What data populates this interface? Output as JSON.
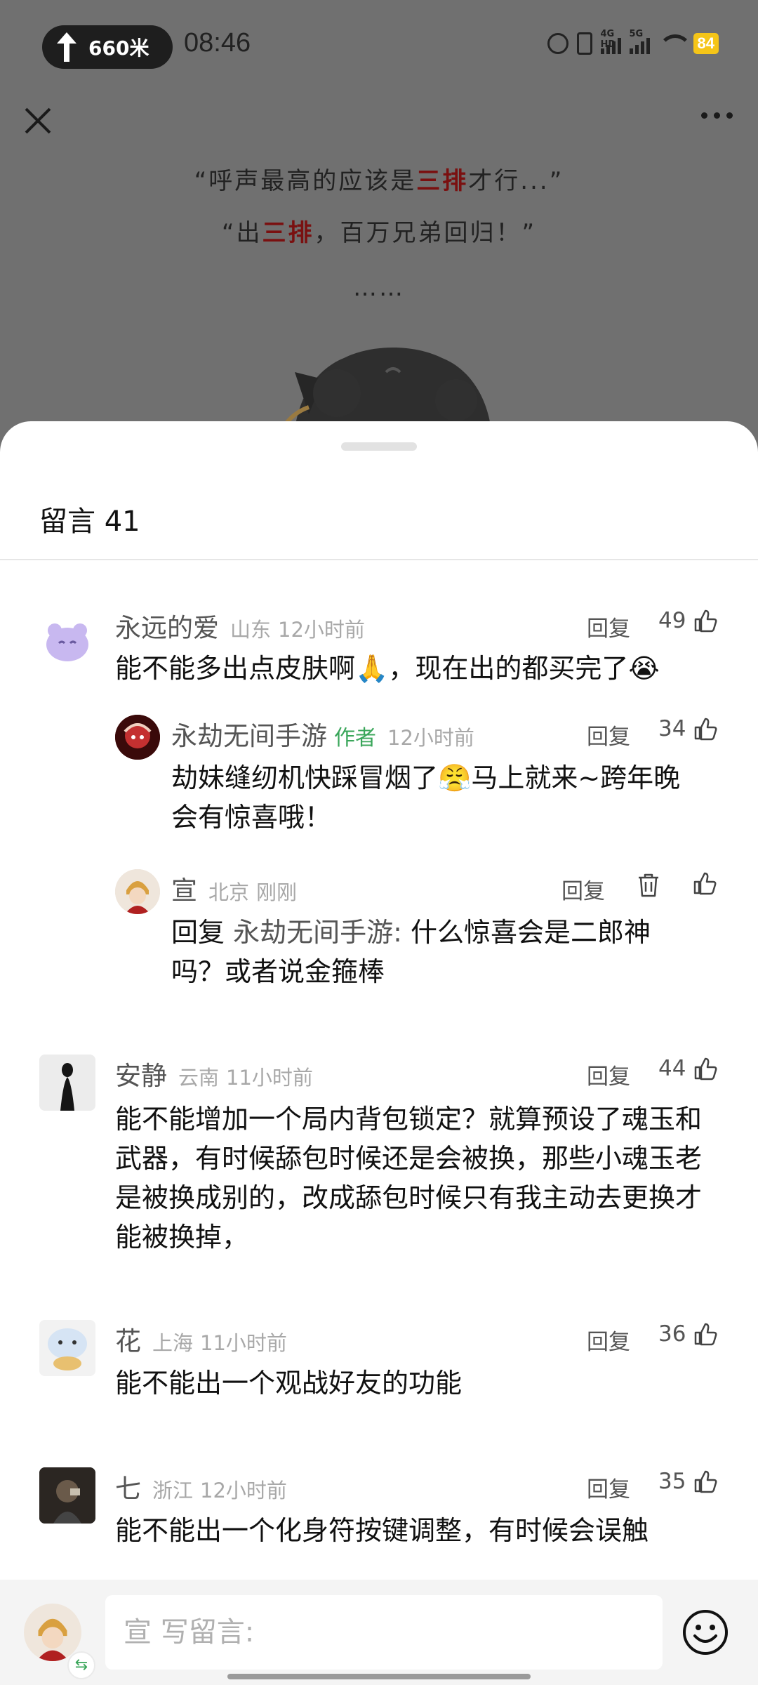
{
  "status_bar": {
    "nav_distance": "660米",
    "time": "08:46",
    "signal_1": "4G HD",
    "signal_2": "5G",
    "battery": "84"
  },
  "article": {
    "quote_1_pre": "“呼声最高的应该是",
    "quote_1_hl": "三排",
    "quote_1_post": "才行...”",
    "quote_2_pre": "“出",
    "quote_2_hl": "三排",
    "quote_2_post": "，百万兄弟回归！”",
    "ellipsis": "……"
  },
  "comments_sheet": {
    "title": "留言 41",
    "reply_label": "回复",
    "author_tag": "作者",
    "comments": [
      {
        "name": "永远的爱",
        "location": "山东",
        "time": "12小时前",
        "likes": "49",
        "text": "能不能多出点皮肤啊🙏，现在出的都买完了😭"
      },
      {
        "name": "永劫无间手游",
        "time": "12小时前",
        "likes": "34",
        "text_line1": "劫妹缝纫机快踩冒烟了😤马上就来~跨年晚",
        "text_line2": "会有惊喜哦！"
      },
      {
        "name": "宣",
        "location": "北京",
        "time": "刚刚",
        "reply_prefix": "回复 ",
        "mention": "永劫无间手游:",
        "text_line1": " 什么惊喜会是二郎神",
        "text_line2": "吗？或者说金箍棒"
      },
      {
        "name": "安静",
        "location": "云南",
        "time": "11小时前",
        "likes": "44",
        "text": "能不能增加一个局内背包锁定？就算预设了魂玉和武器，有时候舔包时候还是会被换，那些小魂玉老是被换成别的，改成舔包时候只有我主动去更换才能被换掉，"
      },
      {
        "name": "花",
        "location": "上海",
        "time": "11小时前",
        "likes": "36",
        "text": "能不能出一个观战好友的功能"
      },
      {
        "name": "七",
        "location": "浙江",
        "time": "12小时前",
        "likes": "35",
        "text": "能不能出一个化身符按键调整，有时候会误触"
      }
    ]
  },
  "composer": {
    "placeholder": "宣 写留言:"
  },
  "icons": {
    "close": "close-icon",
    "more": "more-icon",
    "like": "thumbs-up-icon",
    "delete": "trash-icon",
    "emoji": "smiley-icon",
    "swap": "swap-icon"
  },
  "colors": {
    "author_tag": "#3aa65a",
    "highlight": "#7a1010",
    "battery": "#f5c518"
  }
}
